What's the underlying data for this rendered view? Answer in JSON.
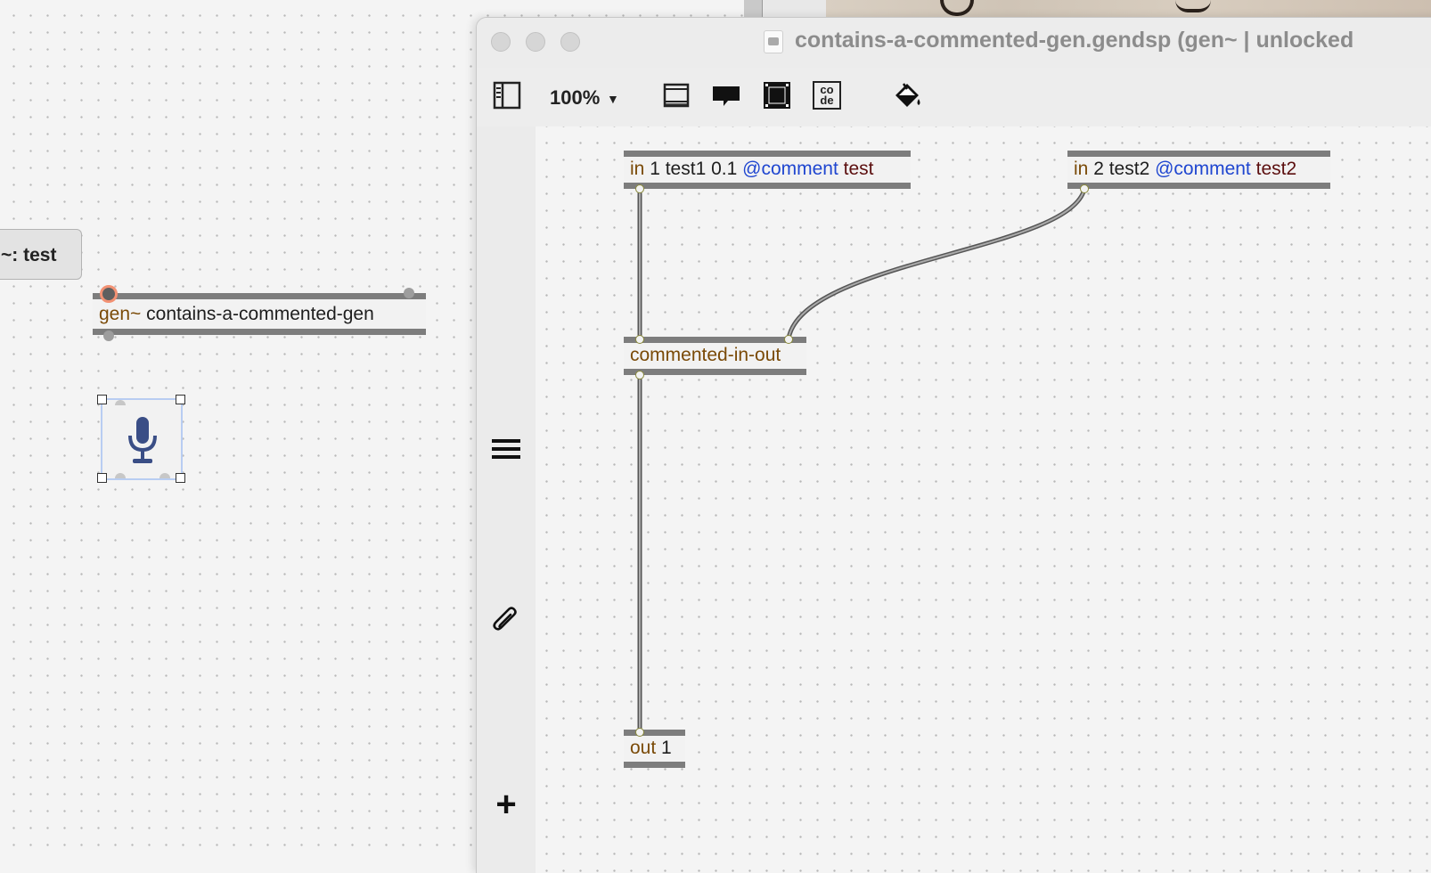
{
  "main_patcher": {
    "message_box": {
      "text": "~: test"
    },
    "gen_object": {
      "keyword": "gen~",
      "name": "contains-a-commented-gen"
    },
    "mic_object": {
      "icon": "microphone-icon"
    }
  },
  "gen_window": {
    "title": "contains-a-commented-gen.gendsp (gen~ | unlocked",
    "toolbar": {
      "zoom": "100%",
      "zoom_arrow": "▼",
      "icons": [
        "sidebar-toggle-icon",
        "presentation-icon",
        "comment-icon",
        "frame-icon",
        "code-icon",
        "paint-bucket-icon"
      ],
      "code_icon_text_top": "co",
      "code_icon_text_bottom": "de"
    },
    "sidebar": {
      "icons": [
        "menu-icon",
        "paperclip-icon",
        "add-icon"
      ],
      "add_label": "+"
    },
    "objects": {
      "in1": {
        "op": "in",
        "args": "1 test1 0.1",
        "attr": "@comment",
        "value": "test"
      },
      "in2": {
        "op": "in",
        "args": "2 test2",
        "attr": "@comment",
        "value": "test2"
      },
      "mid": {
        "op": "commented-in-out"
      },
      "out1": {
        "op": "out",
        "args": "1"
      }
    }
  }
}
